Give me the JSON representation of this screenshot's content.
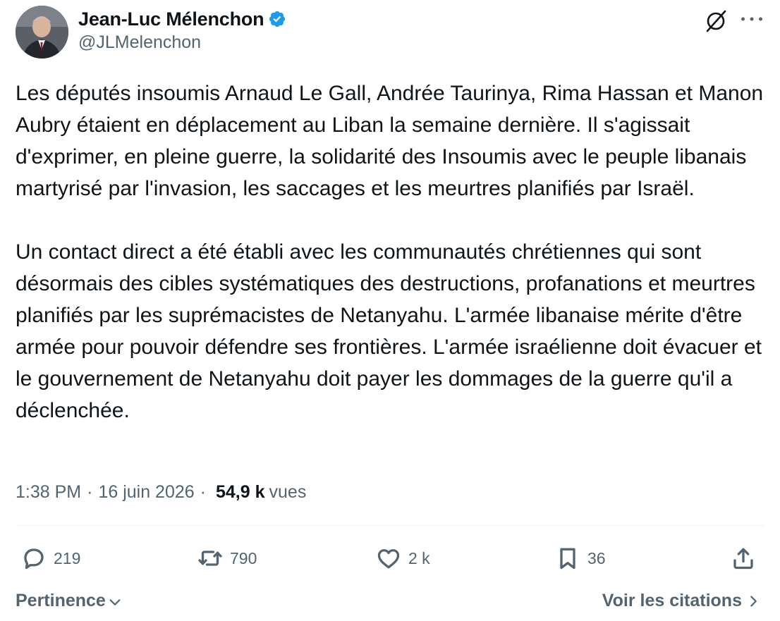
{
  "author": {
    "display_name": "Jean-Luc Mélenchon",
    "handle": "@JLMelenchon",
    "verified": true,
    "verified_color": "#1d9bf0"
  },
  "tweet": {
    "text": "Les députés insoumis Arnaud Le Gall, Andrée Taurinya, Rima Hassan et Manon Aubry étaient en déplacement au Liban la semaine dernière. Il s'agissait d'exprimer, en pleine guerre, la solidarité des Insoumis avec le peuple libanais martyrisé par l'invasion, les saccages et les meurtres planifiés par Israël.\n\nUn contact direct a été établi avec les communautés chrétiennes qui sont désormais des cibles systématiques des destructions, profanations et meurtres planifiés par les suprémacistes de Netanyahu. L'armée libanaise mérite d'être armée pour pouvoir défendre ses frontières. L'armée israélienne doit évacuer et le gouvernement de Netanyahu doit payer les dommages de la guerre qu'il a déclenchée.",
    "time": "1:38 PM",
    "date": "16 juin 2026",
    "views_count": "54,9 k",
    "views_label": "vues"
  },
  "actions": {
    "replies": "219",
    "retweets": "790",
    "likes": "2 k",
    "bookmarks": "36"
  },
  "footer": {
    "sort_label": "Pertinence",
    "quotes_label": "Voir les citations"
  },
  "icons": {
    "grok": "grok-icon",
    "more": "more-icon",
    "reply": "reply-icon",
    "retweet": "retweet-icon",
    "like": "heart-icon",
    "bookmark": "bookmark-icon",
    "share": "share-icon"
  },
  "colors": {
    "text_primary": "#0f1419",
    "text_secondary": "#536471",
    "divider": "#eff3f4"
  }
}
